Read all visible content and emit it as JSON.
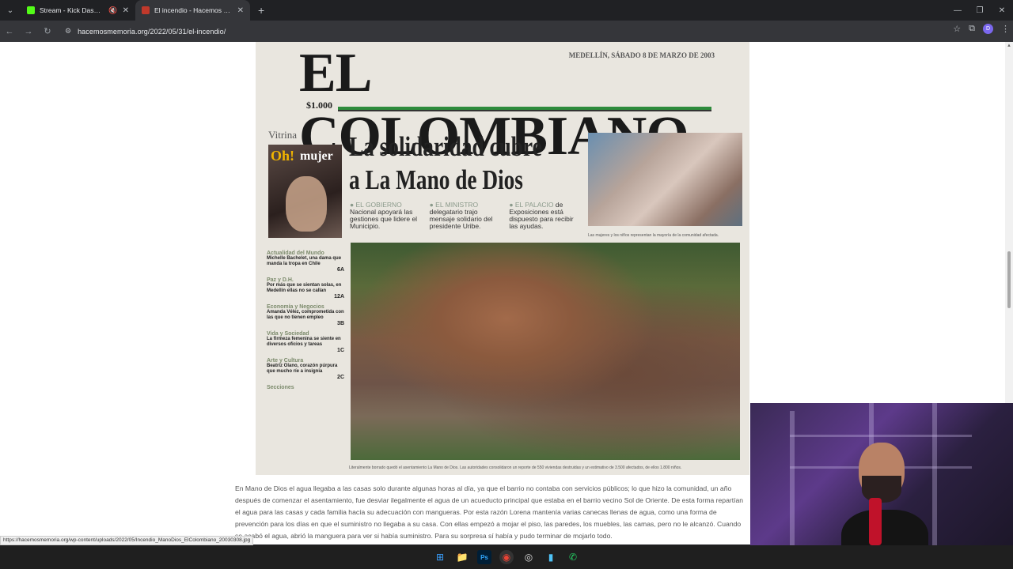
{
  "browser": {
    "tabs": [
      {
        "title": "Stream - Kick Dashboard",
        "active": false,
        "favicon_color": "#53fc18"
      },
      {
        "title": "El incendio - Hacemos Memoria",
        "active": true,
        "favicon_color": "#c0392b"
      }
    ],
    "new_tab_label": "+",
    "url": "hacemosmemoria.org/2022/05/31/el-incendio/",
    "profile_initial": "D"
  },
  "newspaper": {
    "masthead": "EL COLOMBIANO",
    "dateline": "MEDELLÍN, SÁBADO 8 DE MARZO DE 2003",
    "price": "$1.000",
    "vitrina": "Vitrina",
    "oh": "Oh!",
    "mujer": "mujer",
    "headline_1": "La solidaridad cubre",
    "headline_2": "a La Mano de Dios",
    "subs": [
      {
        "lead": "● EL GOBIERNO",
        "text": "Nacional apoyará las gestiones que lidere el Municipio."
      },
      {
        "lead": "● EL MINISTRO",
        "text": "delegatario trajo mensaje solidario del presidente Uribe."
      },
      {
        "lead": "● EL PALACIO",
        "text": "de Exposiciones está dispuesto para recibir las ayudas."
      }
    ],
    "top_caption": "Las mujeres y los niños representan la mayoría de la comunidad afectada.",
    "sidebar": [
      {
        "section": "Actualidad del Mundo",
        "text": "Michelle Bachelet, una dama que manda la tropa en Chile",
        "page": "6A"
      },
      {
        "section": "Paz y D.H.",
        "text": "Por más que se sientan solas, en Medellín ellas no se callan",
        "page": "12A"
      },
      {
        "section": "Economía y Negocios",
        "text": "Amanda Vélez, comprometida con las que no tienen empleo",
        "page": "3B"
      },
      {
        "section": "Vida y Sociedad",
        "text": "La firmeza femenina se siente en diversos oficios y tareas",
        "page": "1C"
      },
      {
        "section": "Arte y Cultura",
        "text": "Beatriz Olano, corazón púrpura que mucho ríe a insignia",
        "page": "2C"
      },
      {
        "section": "Secciones",
        "text": "",
        "page": ""
      }
    ],
    "main_caption": "Literalmente borrado quedó el asentamiento La Mano de Dios. Las autoridades consolidaron un reporte de 550 viviendas destruidas y un estimativo de 3.500 afectados, de ellos 1.800 niños."
  },
  "article": {
    "text": "En Mano de Dios el agua llegaba a las casas solo durante algunas horas al día, ya que el barrio no contaba con servicios públicos; lo que hizo la comunidad, un año después de comenzar el asentamiento, fue desviar ilegalmente el agua de un acueducto principal que estaba en el barrio vecino Sol de Oriente. De esta forma repartían el agua para las casas y cada familia hacía su adecuación con mangueras. Por esta razón Lorena mantenía varias canecas llenas de agua, como una forma de prevención para los días en que el suministro no llegaba a su casa. Con ellas empezó a mojar el piso, las paredes, los muebles, las camas, pero no le alcanzó. Cuando se acabó el agua, abrió la manguera para ver si había suministro. Para su sorpresa sí había y pudo terminar de mojarlo todo."
  },
  "status_url": "https://hacemosmemoria.org/wp-content/uploads/2022/05/Incendio_ManoDios_ElColombiano_20030308.jpg",
  "taskbar": {
    "icons": [
      "windows-start",
      "file-explorer",
      "photoshop",
      "chrome",
      "obs",
      "app",
      "whatsapp"
    ],
    "ps_label": "Ps"
  }
}
